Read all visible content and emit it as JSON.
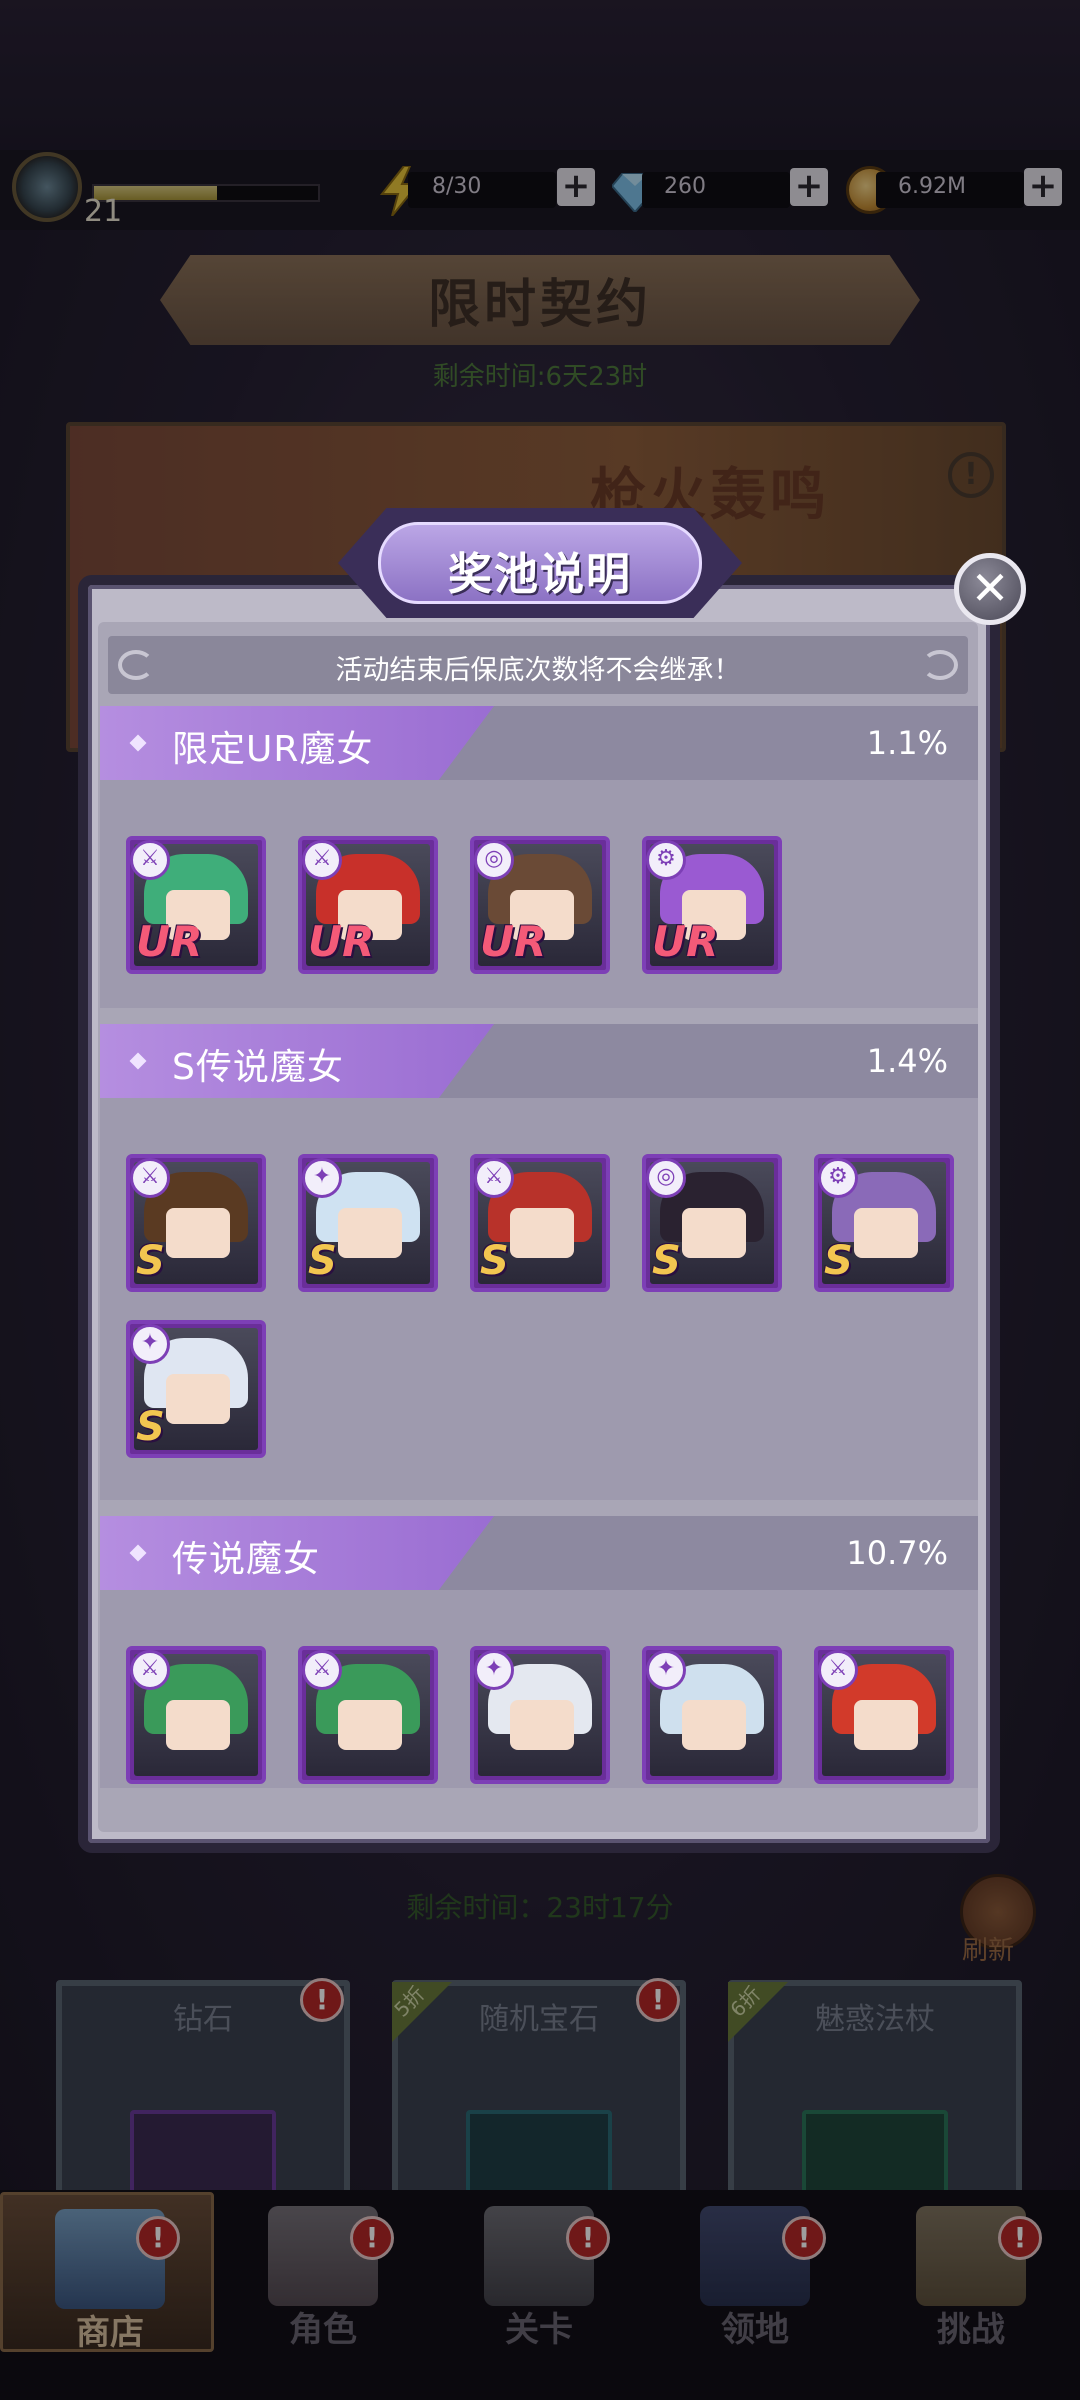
{
  "topbar": {
    "level": "21",
    "xp_progress": 0.55,
    "energy": "8/30",
    "gems": "260",
    "gold": "6.92M",
    "plus": "+"
  },
  "background": {
    "banner_title": "限时契约",
    "remaining_time": "剩余时间:6天23时",
    "event_title": "枪火轰鸣",
    "info_icon": "!",
    "shop_remaining_time": "剩余时间：23时17分",
    "refresh_label": "刷新",
    "shop_cards": [
      {
        "label": "钻石",
        "discount": ""
      },
      {
        "label": "随机宝石",
        "discount": "5折"
      },
      {
        "label": "魅惑法杖",
        "discount": "6折"
      }
    ]
  },
  "nav": {
    "items": [
      {
        "label": "商店",
        "active": true
      },
      {
        "label": "角色",
        "active": false
      },
      {
        "label": "关卡",
        "active": false
      },
      {
        "label": "领地",
        "active": false
      },
      {
        "label": "挑战",
        "active": false
      }
    ],
    "alert": "!"
  },
  "modal": {
    "title": "奖池说明",
    "close_icon": "close-icon",
    "notice": "活动结束后保底次数将不会继承！",
    "sections": [
      {
        "label": "限定UR魔女",
        "rate": "1.1%",
        "rank": "UR",
        "cards": [
          {
            "hair": "#3fae7a",
            "icon": "sword"
          },
          {
            "hair": "#c8302a",
            "icon": "sword"
          },
          {
            "hair": "#6a4a36",
            "icon": "swirl"
          },
          {
            "hair": "#9a5ad2",
            "icon": "gear"
          }
        ]
      },
      {
        "label": "S传说魔女",
        "rate": "1.4%",
        "rank": "S",
        "cards": [
          {
            "hair": "#5a3a22",
            "icon": "sword"
          },
          {
            "hair": "#cfe2f2",
            "icon": "staff"
          },
          {
            "hair": "#b8322a",
            "icon": "sword"
          },
          {
            "hair": "#2a2230",
            "icon": "swirl"
          },
          {
            "hair": "#8a6ab8",
            "icon": "gear"
          },
          {
            "hair": "#dfe6f2",
            "icon": "staff"
          }
        ]
      },
      {
        "label": "传说魔女",
        "rate": "10.7%",
        "rank": "",
        "cards": [
          {
            "hair": "#3a9a5a",
            "icon": "sword"
          },
          {
            "hair": "#3a9a5a",
            "icon": "sword"
          },
          {
            "hair": "#e4e8f0",
            "icon": "staff"
          },
          {
            "hair": "#cfe0ee",
            "icon": "staff"
          },
          {
            "hair": "#d23a2a",
            "icon": "sword"
          }
        ]
      }
    ]
  }
}
